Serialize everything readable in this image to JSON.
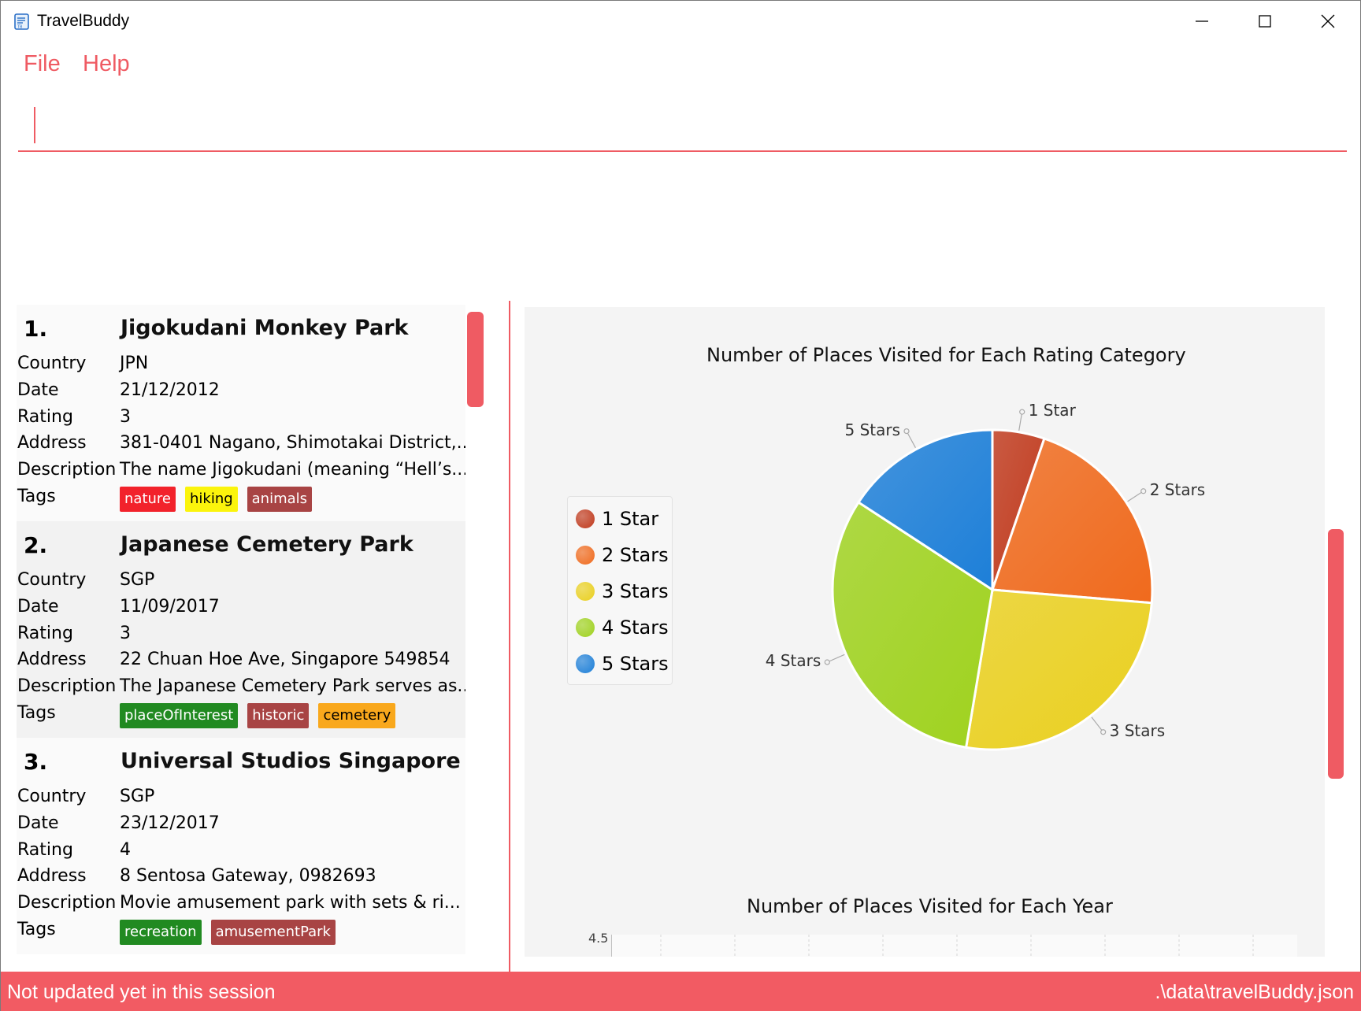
{
  "window": {
    "title": "TravelBuddy",
    "icon": "notebook-app-icon"
  },
  "menu": {
    "file": "File",
    "help": "Help"
  },
  "command": {
    "value": "",
    "placeholder": ""
  },
  "places": [
    {
      "index": "1.",
      "name": "Jigokudani Monkey Park",
      "fields": [
        {
          "label": "Country",
          "value": "JPN"
        },
        {
          "label": "Date",
          "value": "21/12/2012"
        },
        {
          "label": "Rating",
          "value": "3"
        },
        {
          "label": "Address",
          "value": "381-0401 Nagano, Shimotakai District,..."
        },
        {
          "label": "Description",
          "value": "The name Jigokudani (meaning “Hell’s..."
        }
      ],
      "tags_label": "Tags",
      "tags": [
        {
          "text": "nature",
          "color": "#f2222b"
        },
        {
          "text": "hiking",
          "color": "#fbf40c",
          "text_color": "#000000"
        },
        {
          "text": "animals",
          "color": "#a84444"
        }
      ]
    },
    {
      "index": "2.",
      "name": "Japanese Cemetery Park",
      "fields": [
        {
          "label": "Country",
          "value": "SGP"
        },
        {
          "label": "Date",
          "value": "11/09/2017"
        },
        {
          "label": "Rating",
          "value": "3"
        },
        {
          "label": "Address",
          "value": "22 Chuan Hoe Ave, Singapore 549854"
        },
        {
          "label": "Description",
          "value": "The Japanese Cemetery Park serves as..."
        }
      ],
      "tags_label": "Tags",
      "tags": [
        {
          "text": "placeOfInterest",
          "color": "#218a21"
        },
        {
          "text": "historic",
          "color": "#a84444"
        },
        {
          "text": "cemetery",
          "color": "#f9a81c",
          "text_color": "#000000"
        }
      ]
    },
    {
      "index": "3.",
      "name": "Universal Studios Singapore",
      "fields": [
        {
          "label": "Country",
          "value": "SGP"
        },
        {
          "label": "Date",
          "value": "23/12/2017"
        },
        {
          "label": "Rating",
          "value": "4"
        },
        {
          "label": "Address",
          "value": "8 Sentosa Gateway, 0982693"
        },
        {
          "label": "Description",
          "value": "Movie amusement park with sets & ri..."
        }
      ],
      "tags_label": "Tags",
      "tags": [
        {
          "text": "recreation",
          "color": "#218a21"
        },
        {
          "text": "amusementPark",
          "color": "#a84444"
        }
      ]
    }
  ],
  "chart_data": [
    {
      "type": "pie",
      "title": "Number of Places Visited for Each Rating Category",
      "categories": [
        "1 Star",
        "2 Stars",
        "3 Stars",
        "4 Stars",
        "5 Stars"
      ],
      "values": [
        1,
        4,
        5,
        6,
        3
      ],
      "colors": [
        "#c0391c",
        "#f06a1d",
        "#ead01e",
        "#9fd21e",
        "#1d7fd8"
      ],
      "legend": "left"
    },
    {
      "type": "bar",
      "title": "Number of Places Visited for Each Year",
      "ytick_top": "4.5"
    }
  ],
  "status": {
    "left": "Not updated yet in this session",
    "right": ".\\data\\travelBuddy.json"
  },
  "colors": {
    "accent": "#ef5b63",
    "statusbar": "#f25b63"
  }
}
